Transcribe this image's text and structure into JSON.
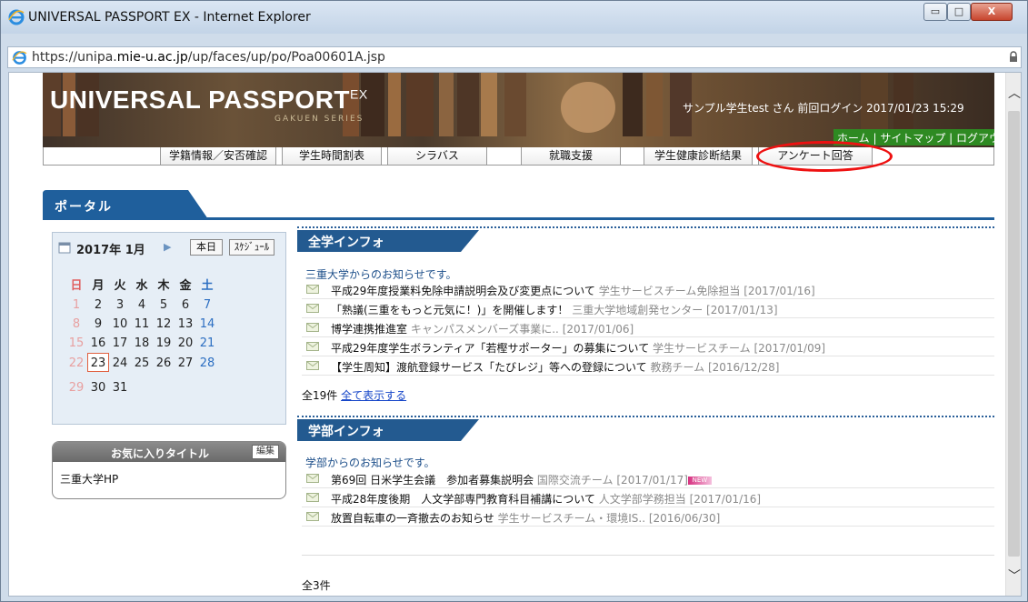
{
  "window": {
    "title": "UNIVERSAL PASSPORT EX - Internet Explorer",
    "controls": {
      "minimize": "▭",
      "maximize": "□",
      "close": "X"
    }
  },
  "address": {
    "prefix": "https://unipa.",
    "domain": "mie-u.ac.jp",
    "path": "/up/faces/up/po/Poa00601A.jsp"
  },
  "banner": {
    "logo": "UNIVERSAL PASSPORT",
    "logo_suffix": "EX",
    "logo_sub": "GAKUEN SERIES",
    "user_info": "サンプル学生test さん 前回ログイン 2017/01/23 15:29",
    "links": {
      "home": "ホーム",
      "sitemap": "サイトマップ",
      "logout": "ログアウト",
      "sep": " | "
    }
  },
  "nav": [
    "学籍情報／安否確認",
    "学生時間割表",
    "シラバス",
    "就職支援",
    "学生健康診断結果",
    "アンケート回答"
  ],
  "portal": {
    "title": "ポータル"
  },
  "calendar": {
    "year_month": "2017年 1月",
    "today_label": "本日",
    "schedule_label": "ｽｹｼﾞｭｰﾙ",
    "dow": [
      "日",
      "月",
      "火",
      "水",
      "木",
      "金",
      "土"
    ],
    "weeks": [
      [
        "1",
        "2",
        "3",
        "4",
        "5",
        "6",
        "7"
      ],
      [
        "8",
        "9",
        "10",
        "11",
        "12",
        "13",
        "14"
      ],
      [
        "15",
        "16",
        "17",
        "18",
        "19",
        "20",
        "21"
      ],
      [
        "22",
        "23",
        "24",
        "25",
        "26",
        "27",
        "28"
      ],
      [
        "29",
        "30",
        "31",
        "",
        "",
        "",
        ""
      ]
    ],
    "today": "23"
  },
  "favorites": {
    "title": "お気に入りタイトル",
    "edit": "編集",
    "items": [
      "三重大学HP"
    ]
  },
  "zengaku": {
    "title": "全学インフォ",
    "intro": "三重大学からのお知らせです。",
    "items": [
      {
        "title": "平成29年度授業料免除申請説明会及び変更点について",
        "meta": "学生サービスチーム免除担当 [2017/01/16]"
      },
      {
        "title": "「熟議(三重をもっと元気に！)」を開催します！",
        "meta": "三重大学地域創発センター [2017/01/13]"
      },
      {
        "title": "博学連携推進室",
        "meta": "キャンパスメンバーズ事業に.. [2017/01/06]"
      },
      {
        "title": "平成29年度学生ボランティア「若樫サポーター」の募集について",
        "meta": "学生サービスチーム [2017/01/09]"
      },
      {
        "title": "【学生周知】渡航登録サービス「たびレジ」等への登録について",
        "meta": "教務チーム [2016/12/28]"
      }
    ],
    "count": "全19件",
    "show_all": "全て表示する"
  },
  "gakubu": {
    "title": "学部インフォ",
    "intro": "学部からのお知らせです。",
    "items": [
      {
        "title": "第69回 日米学生会議　参加者募集説明会",
        "meta": "国際交流チーム [2017/01/17]",
        "badge": "NEW"
      },
      {
        "title": "平成28年度後期　人文学部専門教育科目補講について",
        "meta": "人文学部学務担当 [2017/01/16]"
      },
      {
        "title": "放置自転車の一斉撤去のお知らせ",
        "meta": "学生サービスチーム・環境IS.. [2016/06/30]"
      }
    ],
    "count": "全3件"
  },
  "colors": {
    "accent": "#1f5f9c",
    "highlight": "#e11111",
    "green": "#2e8a22"
  }
}
